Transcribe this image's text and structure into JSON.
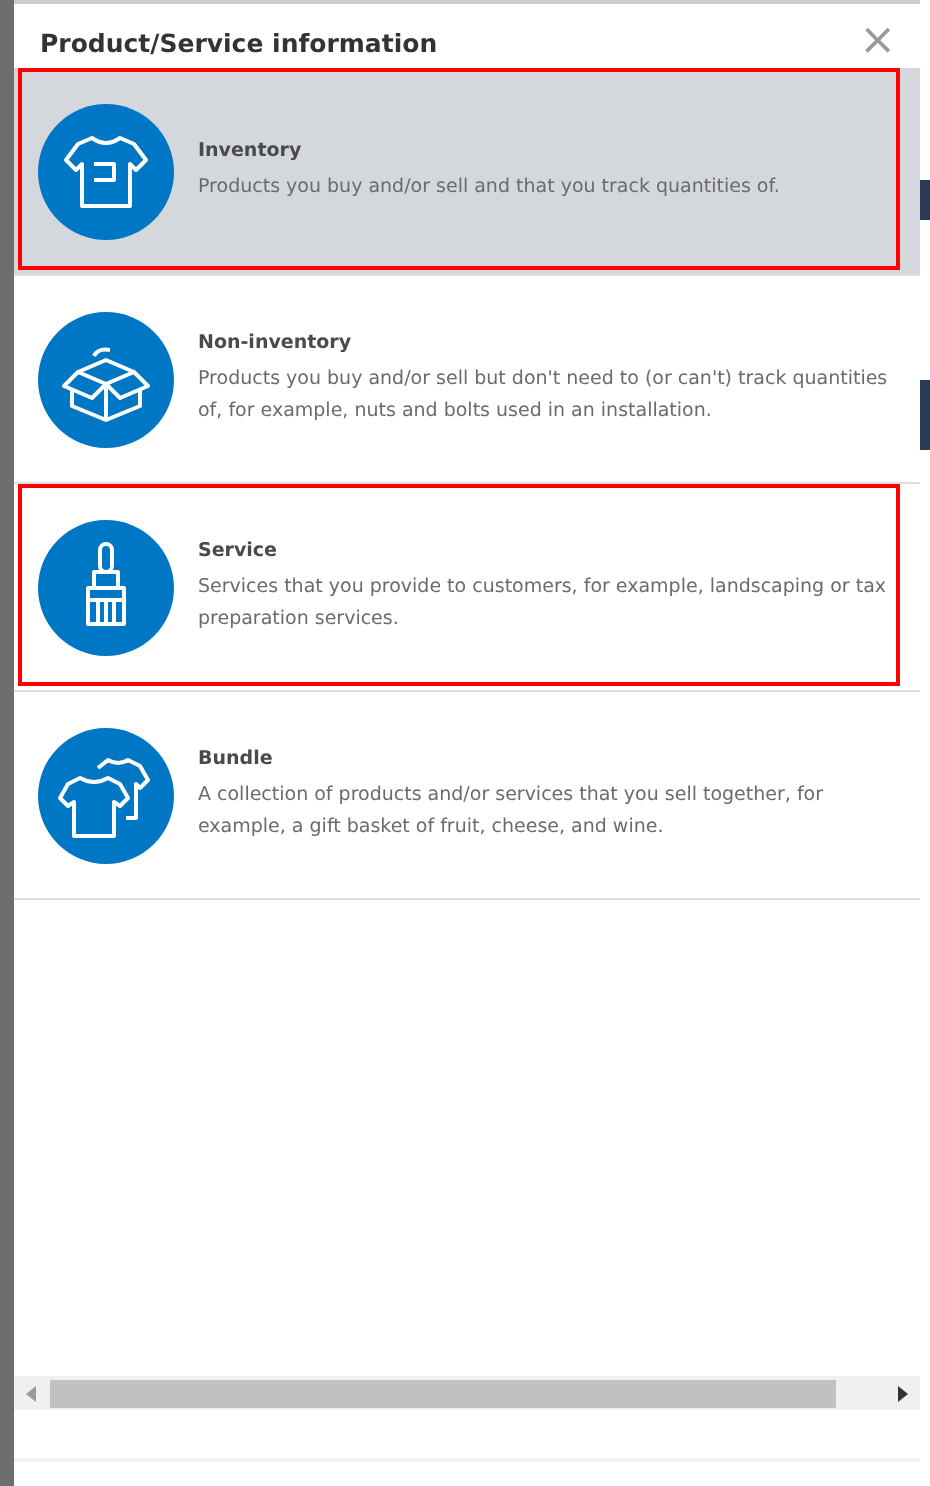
{
  "dialog": {
    "title": "Product/Service information",
    "close": "×"
  },
  "items": [
    {
      "kind": "inventory",
      "title": "Inventory",
      "description": "Products you buy and/or sell and that you track quantities of.",
      "selected": true,
      "highlighted": true
    },
    {
      "kind": "noninventory",
      "title": "Non-inventory",
      "description": "Products you buy and/or sell but don't need to (or can't) track quantities of, for example, nuts and bolts used in an installation.",
      "selected": false,
      "highlighted": false
    },
    {
      "kind": "service",
      "title": "Service",
      "description": "Services that you provide to customers, for example, landscaping or tax preparation services.",
      "selected": false,
      "highlighted": true
    },
    {
      "kind": "bundle",
      "title": "Bundle",
      "description": "A collection of products and/or services that you sell together, for example, a gift basket of fruit, cheese, and wine.",
      "selected": false,
      "highlighted": false
    }
  ]
}
